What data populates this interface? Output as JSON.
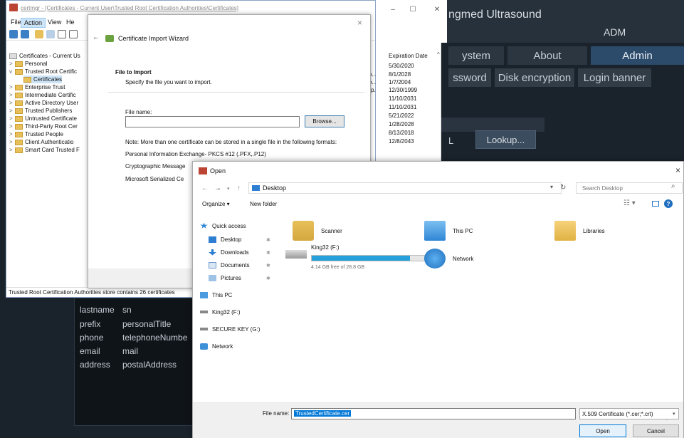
{
  "dark_app": {
    "title": "ngmed Ultrasound",
    "user": "ADM",
    "tabs": [
      "ystem",
      "About",
      "Admin"
    ],
    "subtabs": [
      "ssword",
      "Disk encryption",
      "Login banner"
    ],
    "fragment_l": "L",
    "lookup_label": "Lookup...",
    "mappings": [
      {
        "key": "lastname",
        "value": "sn"
      },
      {
        "key": "prefix",
        "value": "personalTitle"
      },
      {
        "key": "phone",
        "value": "telephoneNumbe"
      },
      {
        "key": "email",
        "value": "mail"
      },
      {
        "key": "address",
        "value": "postalAddress"
      }
    ]
  },
  "certmgr": {
    "title": "certmgr - [Certificates - Current User\\Trusted Root Certification Authorities\\Certificates]",
    "menu": [
      "File",
      "Action",
      "View",
      "He"
    ],
    "tree": [
      {
        "label": "Certificates - Current Us",
        "toggle": "",
        "indent": 0
      },
      {
        "label": "Personal",
        "toggle": ">",
        "indent": 1
      },
      {
        "label": "Trusted Root Certific",
        "toggle": "v",
        "indent": 1
      },
      {
        "label": "Certificates",
        "toggle": "",
        "indent": 2
      },
      {
        "label": "Enterprise Trust",
        "toggle": ">",
        "indent": 1
      },
      {
        "label": "Intermediate Certific",
        "toggle": ">",
        "indent": 1
      },
      {
        "label": "Active Directory User",
        "toggle": ">",
        "indent": 1
      },
      {
        "label": "Trusted Publishers",
        "toggle": ">",
        "indent": 1
      },
      {
        "label": "Untrusted Certificate",
        "toggle": ">",
        "indent": 1
      },
      {
        "label": "Third-Party Root Cer",
        "toggle": ">",
        "indent": 1
      },
      {
        "label": "Trusted People",
        "toggle": ">",
        "indent": 1
      },
      {
        "label": "Client Authenticatio",
        "toggle": ">",
        "indent": 1
      },
      {
        "label": "Smart Card Trusted F",
        "toggle": ">",
        "indent": 1
      }
    ],
    "status": "Trusted Root Certification Authorities store contains 26 certificates",
    "exp_header": "Expiration Date",
    "exp_dates": [
      "5/30/2020",
      "8/1/2028",
      "1/7/2004",
      "12/30/1999",
      "11/10/2031",
      "11/10/2031",
      "5/21/2022",
      "1/28/2028",
      "8/13/2018",
      "12/8/2043"
    ],
    "col_fragments": [
      "tio...",
      "tio...",
      "orp.",
      "ot ..."
    ]
  },
  "wizard": {
    "close": "×",
    "back": "←",
    "title": "Certificate Import Wizard",
    "heading": "File to Import",
    "subheading": "Specify the file you want to import.",
    "filename_label": "File name:",
    "browse_label": "Browse...",
    "notes": [
      "Note:  More than one certificate can be stored in a single file in the following formats:",
      "Personal Information Exchange- PKCS #12 (.PFX,.P12)",
      "Cryptographic Message",
      "Microsoft Serialized Ce"
    ]
  },
  "open_dialog": {
    "title": "Open",
    "close": "×",
    "address": "Desktop",
    "search_placeholder": "Search Desktop",
    "organize": "Organize ▾",
    "new_folder": "New folder",
    "nav": [
      {
        "label": "Quick access",
        "icon": "star-icon",
        "pinned": false
      },
      {
        "label": "Desktop",
        "icon": "desktop-icon",
        "pinned": true
      },
      {
        "label": "Downloads",
        "icon": "download-icon",
        "pinned": true
      },
      {
        "label": "Documents",
        "icon": "documents-icon",
        "pinned": true
      },
      {
        "label": "Pictures",
        "icon": "pictures-icon",
        "pinned": true
      },
      {
        "label": "This PC",
        "icon": "pc-icon",
        "pinned": false
      },
      {
        "label": "King32 (F:)",
        "icon": "drive-icon",
        "pinned": false
      },
      {
        "label": "SECURE KEY (G:)",
        "icon": "drive-icon",
        "pinned": false
      },
      {
        "label": "Network",
        "icon": "network-icon",
        "pinned": false
      }
    ],
    "items": {
      "scanner": "Scanner",
      "this_pc": "This PC",
      "libraries": "Libraries",
      "network": "Network",
      "drive_name": "King32 (F:)",
      "drive_free": "4.14 GB free of 28.8 GB",
      "drive_used_fraction": 0.86
    },
    "filename_label": "File name:",
    "filename_value": "TrustedCertificate.cer",
    "filter": "X.509 Certificate (*.cer;*.crt)",
    "open_label": "Open",
    "cancel_label": "Cancel"
  },
  "colors": {
    "accent": "#0078d7",
    "dark_tab_active": "#2c4a6a",
    "folder": "#e8c05a"
  }
}
